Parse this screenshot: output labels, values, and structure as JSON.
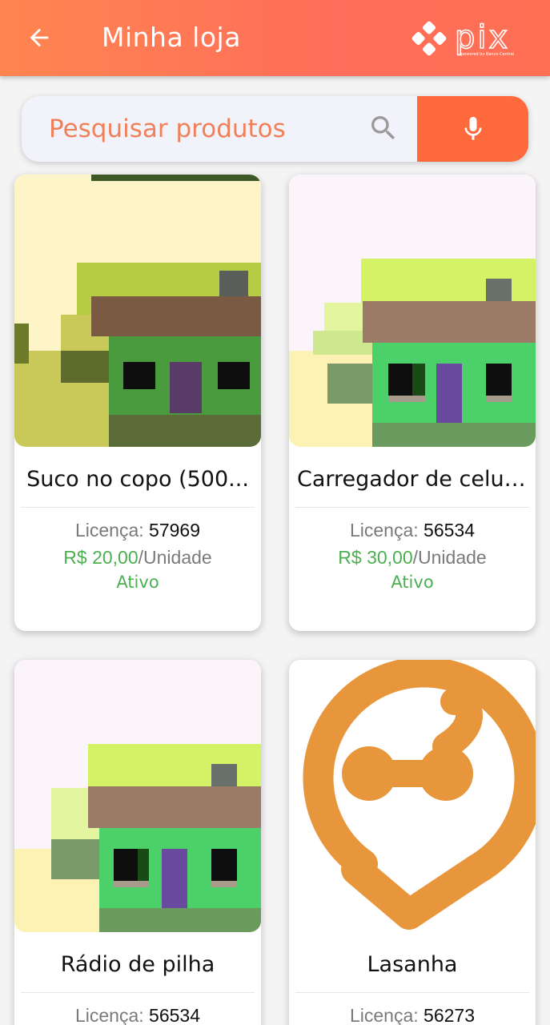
{
  "header": {
    "title": "Minha loja",
    "logo_text": "pix",
    "logo_subtext": "powered by Banco Central"
  },
  "search": {
    "placeholder": "Pesquisar produtos"
  },
  "colors": {
    "header": "#ff7359",
    "accent": "#ff6a3d",
    "price_green": "#4caf50",
    "brand_orange": "#e8963c"
  },
  "icons": {
    "back": "arrow-left-icon",
    "search": "search-icon",
    "mic": "microphone-icon",
    "pix": "pix-logo"
  },
  "products": [
    {
      "name": "Suco no copo (500...",
      "license_label": "Licença: ",
      "license": "57969",
      "price": "R$ 20,00",
      "unit": "/Unidade",
      "status": "Ativo",
      "image": "pixel-house-dark"
    },
    {
      "name": "Carregador de celular",
      "license_label": "Licença: ",
      "license": "56534",
      "price": "R$ 30,00",
      "unit": "/Unidade",
      "status": "Ativo",
      "image": "pixel-house-light"
    },
    {
      "name": "Rádio de pilha",
      "license_label": "Licença: ",
      "license": "56534",
      "price": "",
      "unit": "",
      "status": "",
      "image": "pixel-house-light"
    },
    {
      "name": "Lasanha",
      "license_label": "Licença: ",
      "license": "56273",
      "price": "",
      "unit": "",
      "status": "",
      "image": "brand-logo-orange"
    }
  ]
}
